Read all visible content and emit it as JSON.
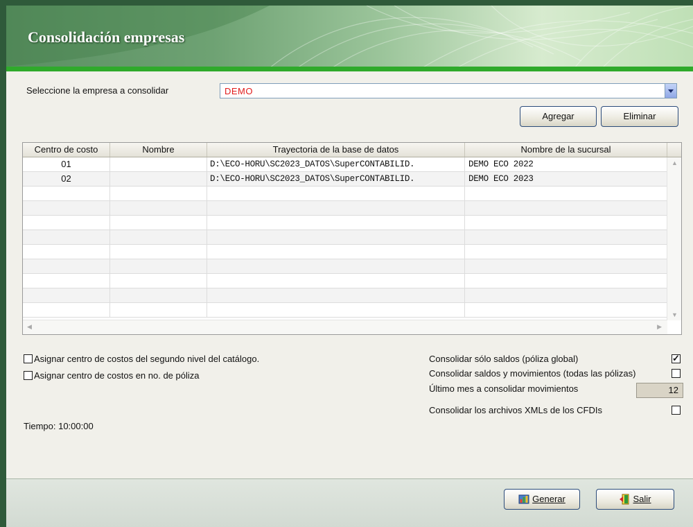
{
  "window": {
    "title": "Consolidación empresas"
  },
  "empresa": {
    "label": "Seleccione la empresa a consolidar",
    "value": "DEMO"
  },
  "buttons": {
    "agregar": "Agregar",
    "eliminar": "Eliminar",
    "generar": "Generar",
    "salir": "Salir"
  },
  "table": {
    "columns": [
      "Centro de costo",
      "Nombre",
      "Trayectoria de la base de datos",
      "Nombre de la sucursal"
    ],
    "rows": [
      {
        "centro": "01",
        "nombre": "",
        "trayectoria": "D:\\ECO-HORU\\SC2023_DATOS\\SuperCONTABILID.",
        "sucursal": "DEMO ECO 2022"
      },
      {
        "centro": "02",
        "nombre": "",
        "trayectoria": "D:\\ECO-HORU\\SC2023_DATOS\\SuperCONTABILID.",
        "sucursal": "DEMO ECO 2023"
      }
    ]
  },
  "options_left": [
    {
      "label": "Asignar centro de costos del segundo nivel del catálogo.",
      "checked": false
    },
    {
      "label": "Asignar centro de costos en no. de póliza",
      "checked": false
    }
  ],
  "options_right": {
    "solo_saldos": {
      "label": "Consolidar sólo saldos (póliza global)",
      "checked": true
    },
    "saldos_movimientos": {
      "label": "Consolidar saldos y movimientos (todas las pólizas)",
      "checked": false
    },
    "ultimo_mes": {
      "label": "Último mes a consolidar movimientos",
      "value": "12"
    },
    "xmls": {
      "label": "Consolidar los archivos XMLs de los CFDIs",
      "checked": false
    }
  },
  "tiempo": "Tiempo: 10:00:00",
  "colors": {
    "accent_green": "#2faa2b",
    "combo_text": "#e11b1b"
  }
}
